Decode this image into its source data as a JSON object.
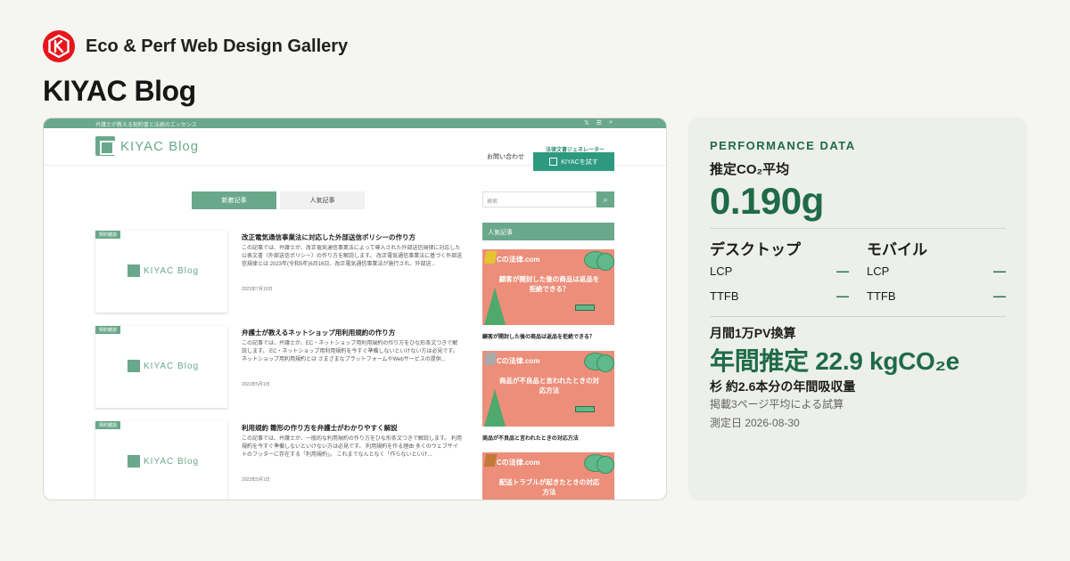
{
  "brand": {
    "name": "Eco & Perf Web Design Gallery",
    "logo_icon": "hexagon-k-logo",
    "logo_color": "#e8141c"
  },
  "site": {
    "title": "KIYAC Blog"
  },
  "screenshot": {
    "topbar_text": "弁護士が教える契約書と法務のエッセンス",
    "topbar_icons": [
      "x-icon",
      "rss-icon",
      "search-icon"
    ],
    "logo_text": "KIYAC Blog",
    "nav_contact": "お問い合わせ",
    "generator_label": "法律文書ジェネレーター",
    "cta_label": "KIYACを試す",
    "tabs": [
      "新着記事",
      "人気記事"
    ],
    "search_placeholder": "検索",
    "popular_heading": "人気記事",
    "category_badge": "契約雑談",
    "thumb_logo": "KIYAC Blog",
    "posts": [
      {
        "title": "改正電気通信事業法に対応した外部送信ポリシーの作り方",
        "excerpt": "この記事では、弁護士が、改正電気通信事業法によって導入された外部送信規律に対応した公表文書（外部送信ポリシー）の作り方を解説します。 改正電気通信事業法に基づく外部送信規律とは 2023年(令和5年)6月16日、改正電気通信事業法が施行され、外部送...",
        "date": "2023年7月10日"
      },
      {
        "title": "弁護士が教えるネットショップ用利用規約の作り方",
        "excerpt": "この記事では、弁護士が、EC・ネットショップ用利用規約の作り方をひな形条文つきで解説します。 EC・ネットショップ用利用規約を今すぐ準備しないといけない方は必見です。 ネットショップ用利用規約とは さまざまなプラットフォームやWebサービスの提供...",
        "date": "2023年5月1日"
      },
      {
        "title": "利用規約 雛形の作り方を弁護士がわかりやすく解説",
        "excerpt": "この記事では、弁護士が、一般的な利用規約の作り方をひな形条文つきで解説します。 利用規約を今すぐ準備しないといけない方は必見です。 利用規約を作る理由 多くのウェブサイトのフッターに存在する「利用規約」。 これまでなんとなく「作らないといけ...",
        "date": "2023年5月1日"
      }
    ],
    "cards": [
      {
        "site": "Cの法律.com",
        "text": "顧客が開封した後の商品は返品を拒絶できる？",
        "caption": "顧客が開封した後の商品は返品を拒絶できる？"
      },
      {
        "site": "Cの法律.com",
        "text": "商品が不良品と言われたときの対応方法",
        "caption": "商品が不良品と言われたときの対応方法"
      },
      {
        "site": "Cの法律.com",
        "text": "配送トラブルが起きたときの対応方法",
        "caption": ""
      }
    ]
  },
  "performance": {
    "section_label": "PERFORMANCE DATA",
    "co2_label": "推定CO₂平均",
    "co2_value": "0.190g",
    "desktop": {
      "title": "デスクトップ",
      "rows": [
        {
          "label": "LCP",
          "value": "—"
        },
        {
          "label": "TTFB",
          "value": "—"
        }
      ]
    },
    "mobile": {
      "title": "モバイル",
      "rows": [
        {
          "label": "LCP",
          "value": "—"
        },
        {
          "label": "TTFB",
          "value": "—"
        }
      ]
    },
    "pv_label": "月間1万PV換算",
    "annual_estimate": "年間推定 22.9 kgCO₂e",
    "trees": "杉 約2.6本分の年間吸収量",
    "note": "掲載3ページ平均による試算",
    "measured_date": "測定日 2026-08-30",
    "accent_color": "#1f6b47"
  }
}
